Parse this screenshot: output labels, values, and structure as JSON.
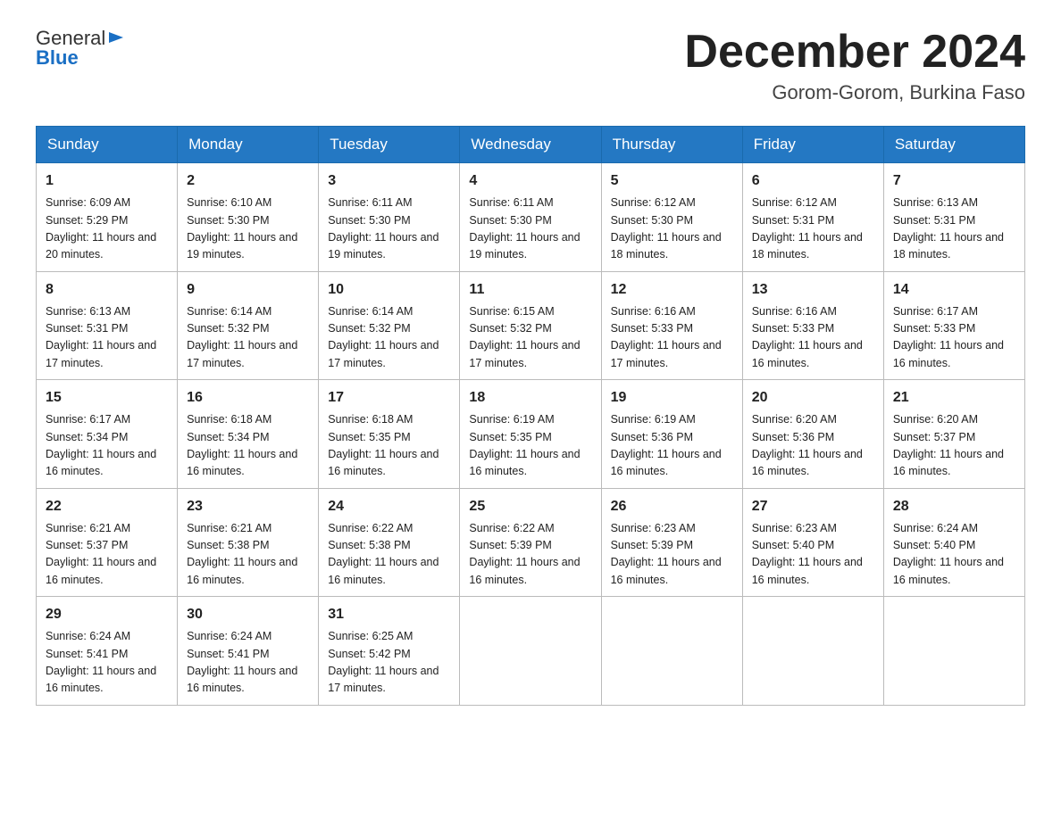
{
  "header": {
    "logo_text_general": "General",
    "logo_text_blue": "Blue",
    "month_title": "December 2024",
    "location": "Gorom-Gorom, Burkina Faso"
  },
  "days_of_week": [
    "Sunday",
    "Monday",
    "Tuesday",
    "Wednesday",
    "Thursday",
    "Friday",
    "Saturday"
  ],
  "weeks": [
    [
      {
        "day": "1",
        "sunrise": "6:09 AM",
        "sunset": "5:29 PM",
        "daylight": "11 hours and 20 minutes."
      },
      {
        "day": "2",
        "sunrise": "6:10 AM",
        "sunset": "5:30 PM",
        "daylight": "11 hours and 19 minutes."
      },
      {
        "day": "3",
        "sunrise": "6:11 AM",
        "sunset": "5:30 PM",
        "daylight": "11 hours and 19 minutes."
      },
      {
        "day": "4",
        "sunrise": "6:11 AM",
        "sunset": "5:30 PM",
        "daylight": "11 hours and 19 minutes."
      },
      {
        "day": "5",
        "sunrise": "6:12 AM",
        "sunset": "5:30 PM",
        "daylight": "11 hours and 18 minutes."
      },
      {
        "day": "6",
        "sunrise": "6:12 AM",
        "sunset": "5:31 PM",
        "daylight": "11 hours and 18 minutes."
      },
      {
        "day": "7",
        "sunrise": "6:13 AM",
        "sunset": "5:31 PM",
        "daylight": "11 hours and 18 minutes."
      }
    ],
    [
      {
        "day": "8",
        "sunrise": "6:13 AM",
        "sunset": "5:31 PM",
        "daylight": "11 hours and 17 minutes."
      },
      {
        "day": "9",
        "sunrise": "6:14 AM",
        "sunset": "5:32 PM",
        "daylight": "11 hours and 17 minutes."
      },
      {
        "day": "10",
        "sunrise": "6:14 AM",
        "sunset": "5:32 PM",
        "daylight": "11 hours and 17 minutes."
      },
      {
        "day": "11",
        "sunrise": "6:15 AM",
        "sunset": "5:32 PM",
        "daylight": "11 hours and 17 minutes."
      },
      {
        "day": "12",
        "sunrise": "6:16 AM",
        "sunset": "5:33 PM",
        "daylight": "11 hours and 17 minutes."
      },
      {
        "day": "13",
        "sunrise": "6:16 AM",
        "sunset": "5:33 PM",
        "daylight": "11 hours and 16 minutes."
      },
      {
        "day": "14",
        "sunrise": "6:17 AM",
        "sunset": "5:33 PM",
        "daylight": "11 hours and 16 minutes."
      }
    ],
    [
      {
        "day": "15",
        "sunrise": "6:17 AM",
        "sunset": "5:34 PM",
        "daylight": "11 hours and 16 minutes."
      },
      {
        "day": "16",
        "sunrise": "6:18 AM",
        "sunset": "5:34 PM",
        "daylight": "11 hours and 16 minutes."
      },
      {
        "day": "17",
        "sunrise": "6:18 AM",
        "sunset": "5:35 PM",
        "daylight": "11 hours and 16 minutes."
      },
      {
        "day": "18",
        "sunrise": "6:19 AM",
        "sunset": "5:35 PM",
        "daylight": "11 hours and 16 minutes."
      },
      {
        "day": "19",
        "sunrise": "6:19 AM",
        "sunset": "5:36 PM",
        "daylight": "11 hours and 16 minutes."
      },
      {
        "day": "20",
        "sunrise": "6:20 AM",
        "sunset": "5:36 PM",
        "daylight": "11 hours and 16 minutes."
      },
      {
        "day": "21",
        "sunrise": "6:20 AM",
        "sunset": "5:37 PM",
        "daylight": "11 hours and 16 minutes."
      }
    ],
    [
      {
        "day": "22",
        "sunrise": "6:21 AM",
        "sunset": "5:37 PM",
        "daylight": "11 hours and 16 minutes."
      },
      {
        "day": "23",
        "sunrise": "6:21 AM",
        "sunset": "5:38 PM",
        "daylight": "11 hours and 16 minutes."
      },
      {
        "day": "24",
        "sunrise": "6:22 AM",
        "sunset": "5:38 PM",
        "daylight": "11 hours and 16 minutes."
      },
      {
        "day": "25",
        "sunrise": "6:22 AM",
        "sunset": "5:39 PM",
        "daylight": "11 hours and 16 minutes."
      },
      {
        "day": "26",
        "sunrise": "6:23 AM",
        "sunset": "5:39 PM",
        "daylight": "11 hours and 16 minutes."
      },
      {
        "day": "27",
        "sunrise": "6:23 AM",
        "sunset": "5:40 PM",
        "daylight": "11 hours and 16 minutes."
      },
      {
        "day": "28",
        "sunrise": "6:24 AM",
        "sunset": "5:40 PM",
        "daylight": "11 hours and 16 minutes."
      }
    ],
    [
      {
        "day": "29",
        "sunrise": "6:24 AM",
        "sunset": "5:41 PM",
        "daylight": "11 hours and 16 minutes."
      },
      {
        "day": "30",
        "sunrise": "6:24 AM",
        "sunset": "5:41 PM",
        "daylight": "11 hours and 16 minutes."
      },
      {
        "day": "31",
        "sunrise": "6:25 AM",
        "sunset": "5:42 PM",
        "daylight": "11 hours and 17 minutes."
      },
      null,
      null,
      null,
      null
    ]
  ]
}
